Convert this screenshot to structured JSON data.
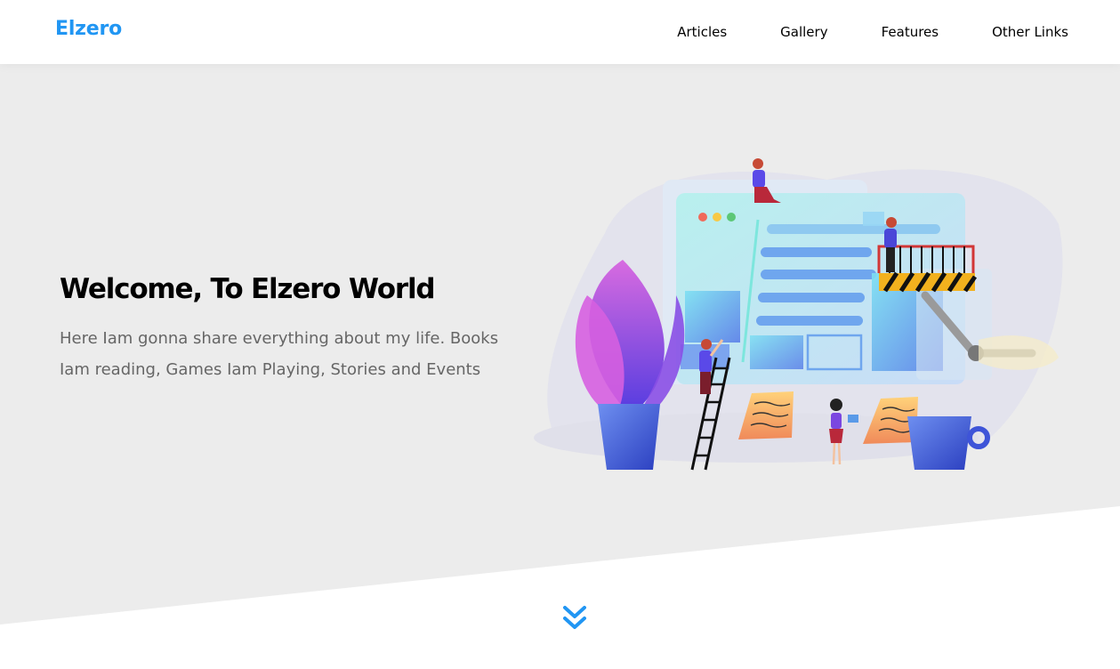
{
  "header": {
    "logo": "Elzero",
    "nav": [
      {
        "label": "Articles"
      },
      {
        "label": "Gallery"
      },
      {
        "label": "Features"
      },
      {
        "label": "Other Links"
      }
    ]
  },
  "landing": {
    "title": "Welcome, To Elzero World",
    "description": "Here Iam gonna share everything about my life. Books Iam reading, Games Iam Playing, Stories and Events",
    "illustration_icon": "website-building-illustration",
    "scroll_icon": "double-chevron-down-icon"
  },
  "colors": {
    "accent": "#2196f3",
    "landing_background": "#ececec",
    "title": "#000000",
    "description": "#666666"
  }
}
